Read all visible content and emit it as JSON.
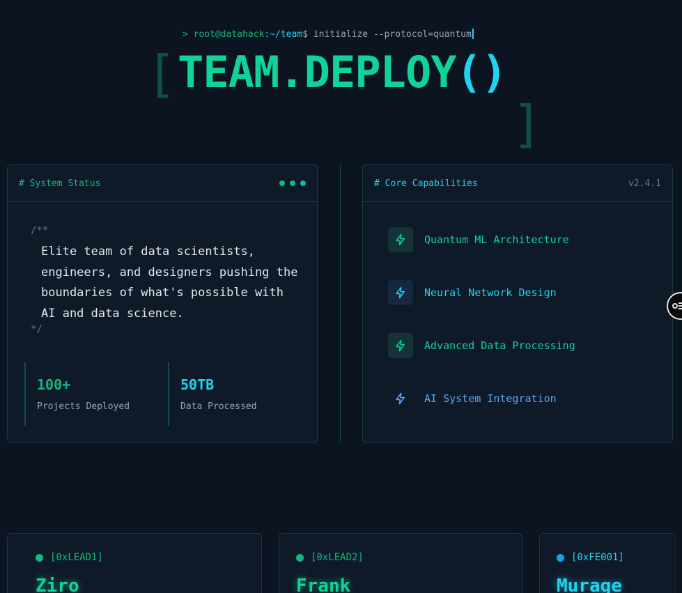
{
  "prompt": {
    "chevron": ">",
    "user": "root@datahack",
    "path": ":~/team",
    "command": "$ initialize --protocol=quantum"
  },
  "hero": {
    "bracket_left": "[",
    "bracket_right": "]",
    "title": "TEAM.DEPLOY",
    "title_parens": "()"
  },
  "status_card": {
    "label": "# System Status",
    "comment_open": "/**",
    "description": "Elite team of data scientists, engineers, and designers pushing the boundaries of what's possible with AI and data science.",
    "comment_close": "*/",
    "stats": [
      {
        "value": "100+",
        "caption": "Projects Deployed"
      },
      {
        "value": "50TB",
        "caption": "Data Processed"
      }
    ]
  },
  "capabilities_card": {
    "label": "# Core Capabilities",
    "version": "v2.4.1",
    "items": [
      {
        "icon": "lightning-icon",
        "label": "Quantum ML Architecture"
      },
      {
        "icon": "lightning-icon",
        "label": "Neural Network Design"
      },
      {
        "icon": "lightning-icon",
        "label": "Advanced Data Processing"
      },
      {
        "icon": "lightning-icon",
        "label": "AI System Integration"
      }
    ]
  },
  "members": [
    {
      "id": "[0xLEAD1]",
      "name": "Ziro"
    },
    {
      "id": "[0xLEAD2]",
      "name": "Frank"
    },
    {
      "id": "[0xFE001]",
      "name": "Murage"
    }
  ],
  "colors": {
    "background": "#0b1420",
    "accent_green": "#10d39a",
    "accent_cyan": "#22d3ee",
    "accent_blue": "#60a5fa"
  }
}
